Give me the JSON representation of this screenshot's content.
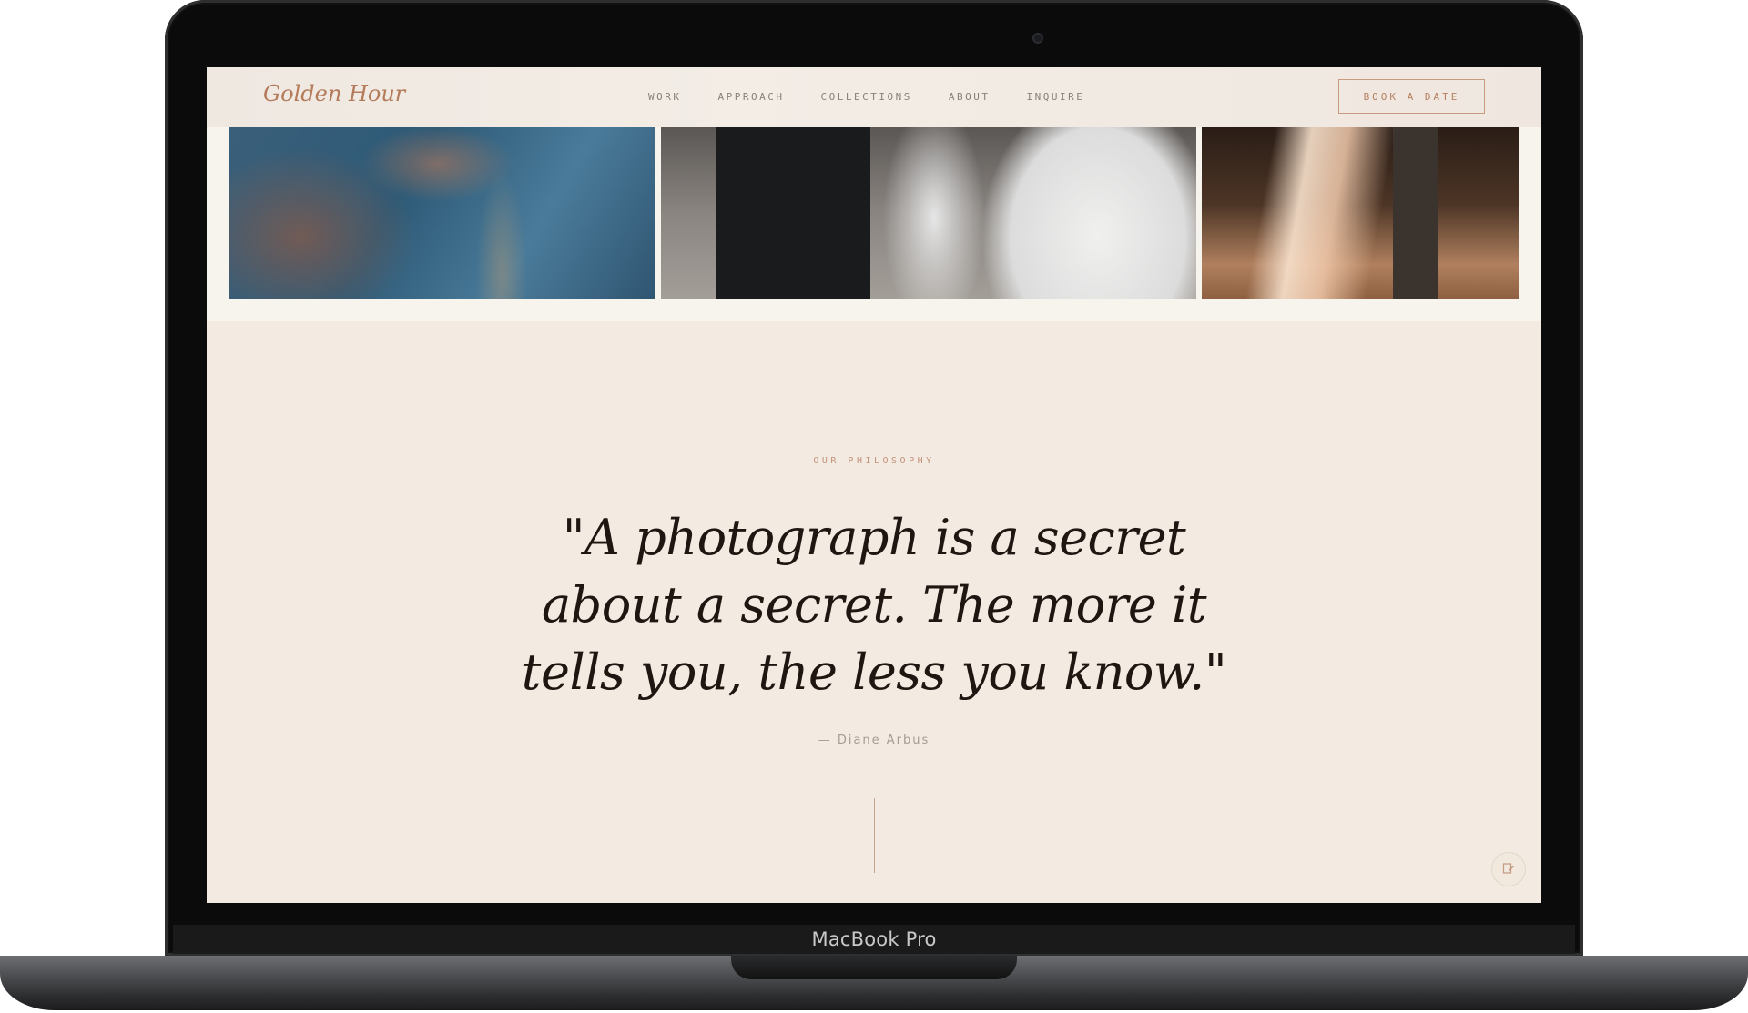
{
  "device": {
    "label": "MacBook Pro"
  },
  "site": {
    "logo": "Golden Hour",
    "nav": [
      {
        "label": "WORK"
      },
      {
        "label": "APPROACH"
      },
      {
        "label": "COLLECTIONS"
      },
      {
        "label": "ABOUT"
      },
      {
        "label": "INQUIRE"
      }
    ],
    "cta": "BOOK A DATE",
    "accent_color": "#b47a5a"
  },
  "philosophy": {
    "eyebrow": "OUR PHILOSOPHY",
    "quote": "\"A photograph is a secret about a secret. The more it tells you, the less you know.\"",
    "attribution": "— Diane Arbus"
  },
  "corner_button": {
    "icon": "edit-document-icon"
  }
}
